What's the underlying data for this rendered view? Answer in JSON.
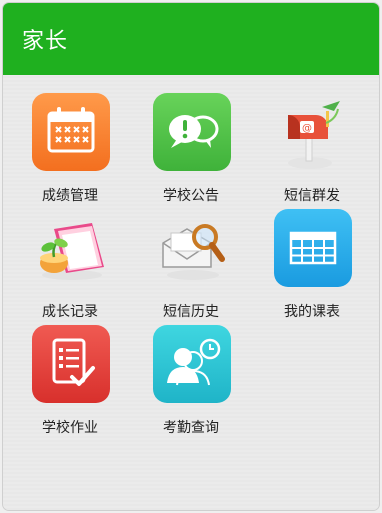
{
  "header": {
    "title": "家长"
  },
  "tiles": [
    {
      "label": "成绩管理",
      "icon": "calendar-icon"
    },
    {
      "label": "学校公告",
      "icon": "chat-bubbles-icon"
    },
    {
      "label": "短信群发",
      "icon": "mailbox-icon"
    },
    {
      "label": "成长记录",
      "icon": "growth-book-icon"
    },
    {
      "label": "短信历史",
      "icon": "envelope-search-icon"
    },
    {
      "label": "我的课表",
      "icon": "timetable-icon"
    },
    {
      "label": "学校作业",
      "icon": "homework-checklist-icon"
    },
    {
      "label": "考勤查询",
      "icon": "attendance-clock-icon"
    }
  ],
  "colors": {
    "header": "#1fb01f",
    "orange": "#f36f1f",
    "green": "#3fb23a",
    "blue": "#1a9be0",
    "red": "#d8302c",
    "teal": "#1fb4c8"
  }
}
